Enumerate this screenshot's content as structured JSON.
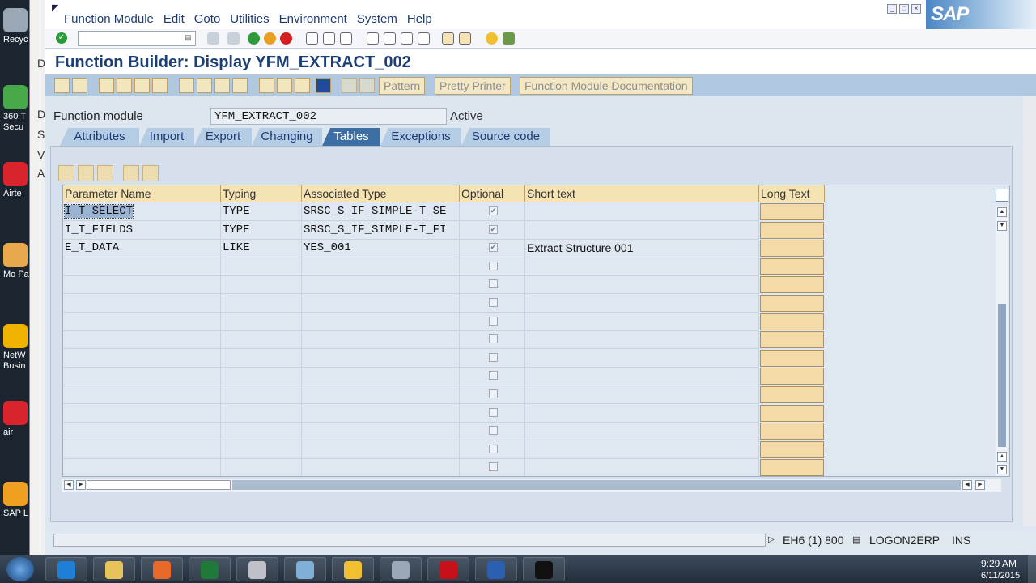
{
  "desktop": {
    "icons": [
      {
        "label": "Recyc",
        "color": "#9aa7b5"
      },
      {
        "label": "360 T Secu",
        "color": "#49a84a"
      },
      {
        "label": "Airte",
        "color": "#d9232d"
      },
      {
        "label": "Mo Par",
        "color": "#e8a84c"
      },
      {
        "label": "NetW Busin",
        "color": "#f0b400"
      },
      {
        "label": "air",
        "color": "#d9232d"
      },
      {
        "label": "SAP L",
        "color": "#f0a020"
      }
    ],
    "bg_letters": [
      "D",
      "D",
      "S",
      "V",
      "A"
    ]
  },
  "menu": [
    "Function Module",
    "Edit",
    "Goto",
    "Utilities",
    "Environment",
    "System",
    "Help"
  ],
  "logo": "SAP",
  "title": "Function Builder: Display YFM_EXTRACT_002",
  "app_toolbar": {
    "buttons": [
      "Pattern",
      "Pretty Printer",
      "Function Module Documentation"
    ]
  },
  "header": {
    "label": "Function module",
    "value": "YFM_EXTRACT_002",
    "status": "Active"
  },
  "tabs": [
    "Attributes",
    "Import",
    "Export",
    "Changing",
    "Tables",
    "Exceptions",
    "Source code"
  ],
  "active_tab": "Tables",
  "table": {
    "columns": [
      "Parameter Name",
      "Typing",
      "Associated Type",
      "Optional",
      "Short text",
      "Long Text"
    ],
    "rows": [
      {
        "name": "I_T_SELECT",
        "typing": "TYPE",
        "assoc": "SRSC_S_IF_SIMPLE-T_SE",
        "optional": true,
        "short": ""
      },
      {
        "name": "I_T_FIELDS",
        "typing": "TYPE",
        "assoc": "SRSC_S_IF_SIMPLE-T_FI",
        "optional": true,
        "short": ""
      },
      {
        "name": "E_T_DATA",
        "typing": "LIKE",
        "assoc": "YES_001",
        "optional": true,
        "short": "Extract Structure 001"
      },
      {
        "name": "",
        "typing": "",
        "assoc": "",
        "optional": false,
        "short": ""
      },
      {
        "name": "",
        "typing": "",
        "assoc": "",
        "optional": false,
        "short": ""
      },
      {
        "name": "",
        "typing": "",
        "assoc": "",
        "optional": false,
        "short": ""
      },
      {
        "name": "",
        "typing": "",
        "assoc": "",
        "optional": false,
        "short": ""
      },
      {
        "name": "",
        "typing": "",
        "assoc": "",
        "optional": false,
        "short": ""
      },
      {
        "name": "",
        "typing": "",
        "assoc": "",
        "optional": false,
        "short": ""
      },
      {
        "name": "",
        "typing": "",
        "assoc": "",
        "optional": false,
        "short": ""
      },
      {
        "name": "",
        "typing": "",
        "assoc": "",
        "optional": false,
        "short": ""
      },
      {
        "name": "",
        "typing": "",
        "assoc": "",
        "optional": false,
        "short": ""
      },
      {
        "name": "",
        "typing": "",
        "assoc": "",
        "optional": false,
        "short": ""
      },
      {
        "name": "",
        "typing": "",
        "assoc": "",
        "optional": false,
        "short": ""
      },
      {
        "name": "",
        "typing": "",
        "assoc": "",
        "optional": false,
        "short": ""
      }
    ]
  },
  "status_bar": {
    "system": "EH6 (1) 800",
    "server": "LOGON2ERP",
    "mode": "INS"
  },
  "taskbar": {
    "apps": [
      {
        "name": "internet-explorer",
        "color": "#1f7fd6"
      },
      {
        "name": "file-explorer",
        "color": "#e8c25a"
      },
      {
        "name": "media-player",
        "color": "#e8682a"
      },
      {
        "name": "excel",
        "color": "#1f7a3a"
      },
      {
        "name": "paint",
        "color": "#c0c0c8"
      },
      {
        "name": "sap-gui",
        "color": "#7fb0d8"
      },
      {
        "name": "sap-logon",
        "color": "#f0c030"
      },
      {
        "name": "calculator",
        "color": "#9aa8b8"
      },
      {
        "name": "adobe-reader",
        "color": "#c8101a"
      },
      {
        "name": "word",
        "color": "#2b5fb0"
      },
      {
        "name": "command-prompt",
        "color": "#111111"
      }
    ],
    "time": "9:29 AM",
    "date": "6/11/2015"
  }
}
